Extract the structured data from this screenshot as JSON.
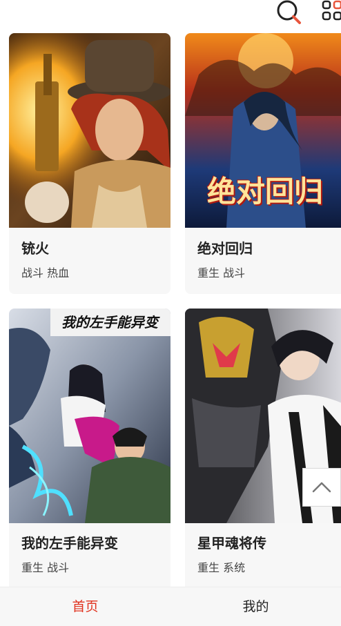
{
  "topbar": {
    "search_icon": "search-icon",
    "grid_icon": "grid-icon",
    "accent": "#e8563d"
  },
  "comics": [
    {
      "title": "铳火",
      "tags": "战斗 热血"
    },
    {
      "title": "绝对回归",
      "tags": "重生 战斗",
      "cover_text": "绝对回归"
    },
    {
      "title": "我的左手能异变",
      "tags": "重生 战斗",
      "cover_text": "我的左手能异变"
    },
    {
      "title": "星甲魂将传",
      "tags": "重生 系统"
    }
  ],
  "back_to_top_icon": "chevron-up-icon",
  "bottom_nav": {
    "home": "首页",
    "mine": "我的",
    "active_color": "#e0321e",
    "inactive_color": "#222222"
  }
}
